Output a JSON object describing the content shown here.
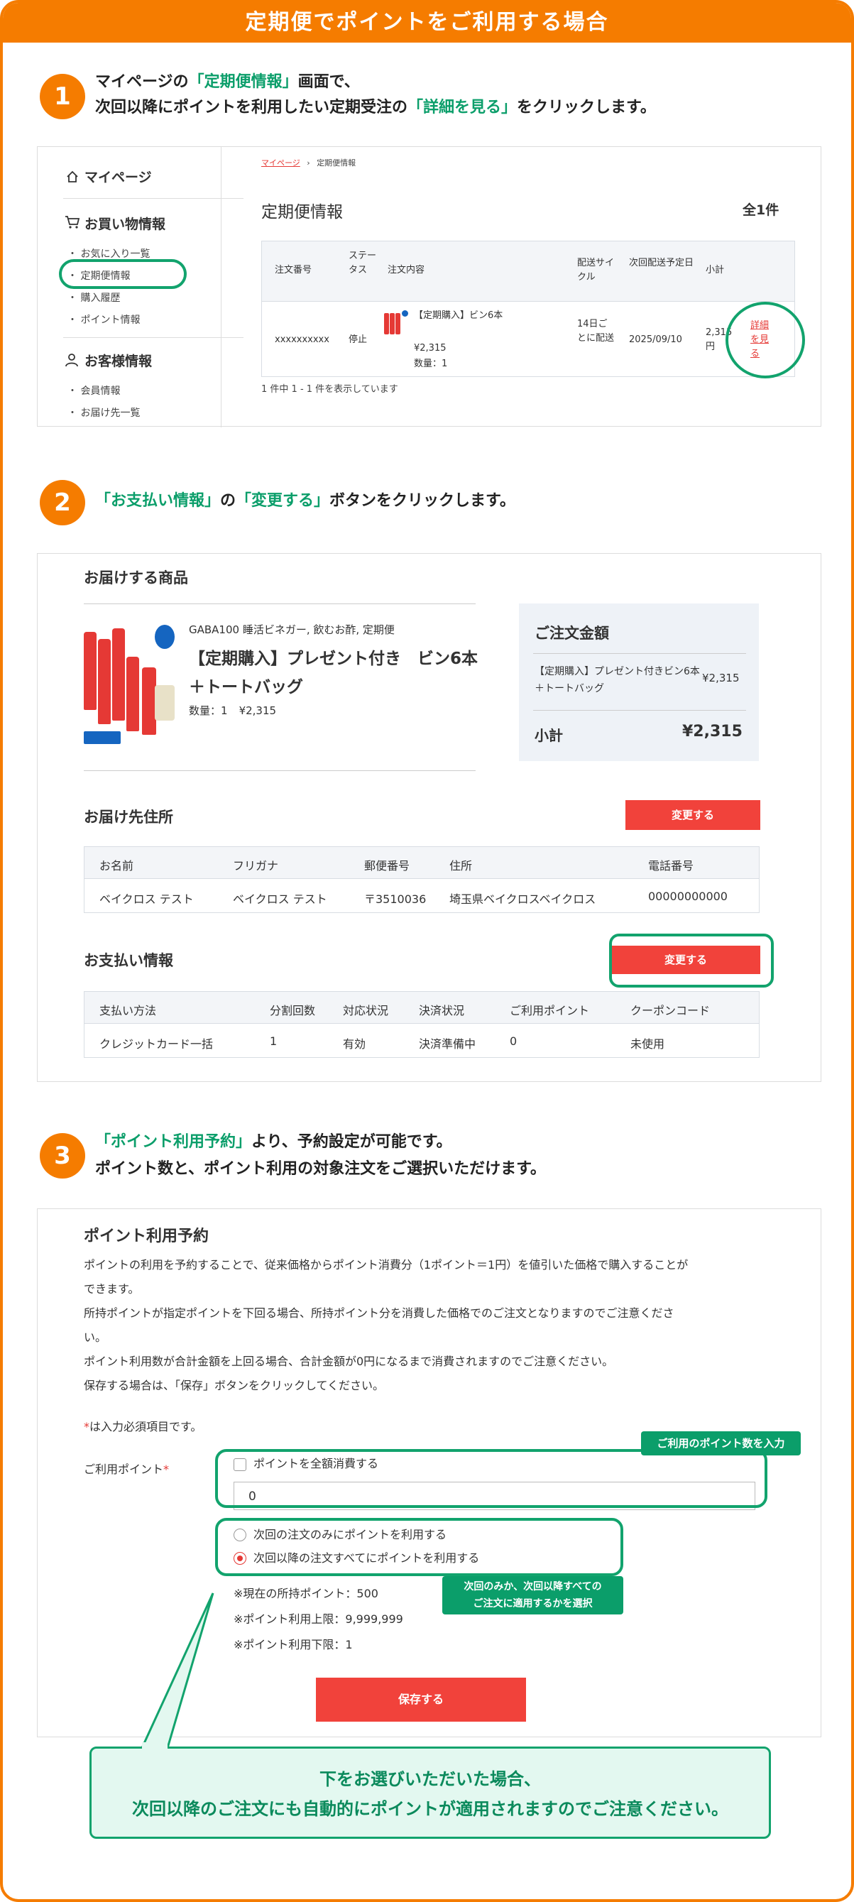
{
  "banner": {
    "title": "定期便でポイントをご利用する場合"
  },
  "step1": {
    "number": "1",
    "line1_a": "マイページの",
    "line1_b": "「定期便情報」",
    "line1_c": "画面で、",
    "line2_a": "次回以降にポイントを利用したい定期受注の",
    "line2_b": "「詳細を見る」",
    "line2_c": "をクリックします。",
    "sidebar": {
      "mypage": "マイページ",
      "shopping": "お買い物情報",
      "shopping_items": [
        "お気に入り一覧",
        "定期便情報",
        "購入履歴",
        "ポイント情報"
      ],
      "customer": "お客様情報",
      "customer_items": [
        "会員情報",
        "お届け先一覧"
      ]
    },
    "breadcrumb": {
      "home": "マイページ",
      "current": "定期便情報"
    },
    "page_title": "定期便情報",
    "count": "全1件",
    "table": {
      "headers": [
        "注文番号",
        "ステータス",
        "注文内容",
        "配送サイクル",
        "次回配送予定日",
        "小計"
      ],
      "row": {
        "order_no": "xxxxxxxxxx",
        "status": "停止",
        "product": "【定期購入】ビン6本",
        "price": "¥2,315",
        "qty": "数量：1",
        "cycle": "14日ごとに配送",
        "next_date": "2025/09/10",
        "subtotal": "2,315円",
        "detail_link": "詳細を見る"
      }
    },
    "pager": "1 件中 1 - 1 件を表示しています"
  },
  "step2": {
    "number": "2",
    "text_a": "「お支払い情報」",
    "text_b": "の",
    "text_c": "「変更する」",
    "text_d": "ボタンをクリックします。",
    "products_title": "お届けする商品",
    "product": {
      "category": "GABA100 睡活ビネガー, 飲むお酢, 定期便",
      "name": "【定期購入】プレゼント付き　ビン6本＋トートバッグ",
      "qty_label": "数量：",
      "qty": "1",
      "price": "¥2,315"
    },
    "summary": {
      "title": "ご注文金額",
      "item": "【定期購入】プレゼント付きビン6本＋トートバッグ",
      "item_price": "¥2,315",
      "subtotal_label": "小計",
      "subtotal": "¥2,315"
    },
    "address": {
      "title": "お届け先住所",
      "change_button": "変更する",
      "headers": [
        "お名前",
        "フリガナ",
        "郵便番号",
        "住所",
        "電話番号"
      ],
      "row": [
        "ベイクロス テスト",
        "ベイクロス テスト",
        "〒3510036",
        "埼玉県ベイクロスベイクロス",
        "00000000000"
      ]
    },
    "payment": {
      "title": "お支払い情報",
      "change_button": "変更する",
      "headers": [
        "支払い方法",
        "分割回数",
        "対応状況",
        "決済状況",
        "ご利用ポイント",
        "クーポンコード"
      ],
      "row": [
        "クレジットカード一括",
        "1",
        "有効",
        "決済準備中",
        "0",
        "未使用"
      ]
    }
  },
  "step3": {
    "number": "3",
    "line1_a": "「ポイント利用予約」",
    "line1_b": "より、予約設定が可能です。",
    "line2": "ポイント数と、ポイント利用の対象注文をご選択いただけます。",
    "title": "ポイント利用予約",
    "desc": [
      "ポイントの利用を予約することで、従来価格からポイント消費分（1ポイント＝1円）を値引いた価格で購入することが",
      "できます。",
      "所持ポイントが指定ポイントを下回る場合、所持ポイント分を消費した価格でのご注文となりますのでご注意くださ",
      "い。",
      "ポイント利用数が合計金額を上回る場合、合計金額が0円になるまで消費されますのでご注意ください。",
      "保存する場合は、「保存」ボタンをクリックしてください。"
    ],
    "required_note": "は入力必須項目です。",
    "required_mark": "*",
    "points_label": "ご利用ポイント",
    "use_all": "ポイントを全額消費する",
    "points_value": "0",
    "callout_points": "ご利用のポイント数を入力",
    "option_next_only": "次回の注文のみにポイントを利用する",
    "option_all_future": "次回以降の注文すべてにポイントを利用する",
    "callout_scope_1": "次回のみか、次回以降すべての",
    "callout_scope_2": "ご注文に適用するかを選択",
    "current_points": "※現在の所持ポイント：500",
    "max_points": "※ポイント利用上限：9,999,999",
    "min_points": "※ポイント利用下限：1",
    "save_button": "保存する",
    "notice_1": "下をお選びいただいた場合、",
    "notice_2": "次回以降のご注文にも自動的にポイントが適用されますのでご注意ください。"
  }
}
